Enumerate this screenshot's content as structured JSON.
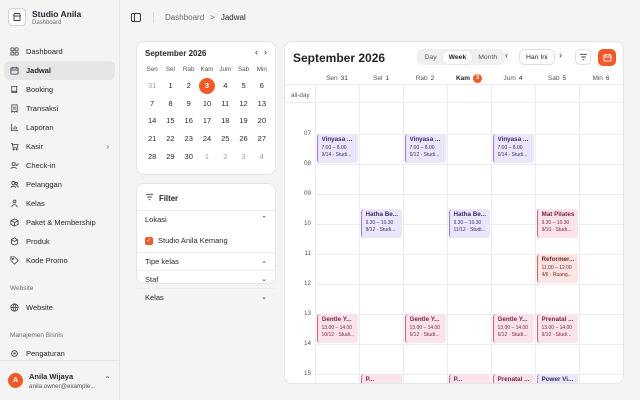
{
  "brand": {
    "title": "Studio Anila",
    "subtitle": "Dashboard"
  },
  "nav": [
    {
      "label": "Dashboard",
      "icon": "grid-icon",
      "active": false
    },
    {
      "label": "Jadwal",
      "icon": "calendar-icon",
      "active": true
    },
    {
      "label": "Booking",
      "icon": "book-icon",
      "active": false
    },
    {
      "label": "Transaksi",
      "icon": "receipt-icon",
      "active": false
    },
    {
      "label": "Laporan",
      "icon": "chart-icon",
      "active": false
    },
    {
      "label": "Kasir",
      "icon": "cart-icon",
      "active": false,
      "chevron": true
    },
    {
      "label": "Check-in",
      "icon": "user-check-icon",
      "active": false
    },
    {
      "label": "Pelanggan",
      "icon": "users-icon",
      "active": false
    },
    {
      "label": "Kelas",
      "icon": "class-icon",
      "active": false
    },
    {
      "label": "Paket & Membership",
      "icon": "package-icon",
      "active": false
    },
    {
      "label": "Produk",
      "icon": "box-icon",
      "active": false
    },
    {
      "label": "Kode Promo",
      "icon": "tag-icon",
      "active": false
    }
  ],
  "sections": {
    "website_label": "Website",
    "website_item": "Website",
    "business_label": "Manajemen Bisnis",
    "business_item": "Pengaturan"
  },
  "user": {
    "initial": "A",
    "name": "Anila Wijaya",
    "email": "anila.owner@example..."
  },
  "breadcrumb": {
    "root": "Dashboard",
    "sep": ">",
    "current": "Jadwal"
  },
  "mini_calendar": {
    "month": "September 2026",
    "prev": "‹",
    "next": "›",
    "dow": [
      "Sen",
      "Sel",
      "Rab",
      "Kam",
      "Jum",
      "Sab",
      "Min"
    ],
    "days": [
      {
        "d": "31",
        "m": true
      },
      {
        "d": "1"
      },
      {
        "d": "2"
      },
      {
        "d": "3",
        "t": true
      },
      {
        "d": "4"
      },
      {
        "d": "5"
      },
      {
        "d": "6"
      },
      {
        "d": "7"
      },
      {
        "d": "8"
      },
      {
        "d": "9"
      },
      {
        "d": "10"
      },
      {
        "d": "11"
      },
      {
        "d": "12"
      },
      {
        "d": "13"
      },
      {
        "d": "14"
      },
      {
        "d": "15"
      },
      {
        "d": "16"
      },
      {
        "d": "17"
      },
      {
        "d": "18"
      },
      {
        "d": "19"
      },
      {
        "d": "20"
      },
      {
        "d": "21"
      },
      {
        "d": "22"
      },
      {
        "d": "23"
      },
      {
        "d": "24"
      },
      {
        "d": "25"
      },
      {
        "d": "26"
      },
      {
        "d": "27"
      },
      {
        "d": "28"
      },
      {
        "d": "29"
      },
      {
        "d": "30"
      },
      {
        "d": "1",
        "m": true
      },
      {
        "d": "2",
        "m": true
      },
      {
        "d": "3",
        "m": true
      },
      {
        "d": "4",
        "m": true
      }
    ]
  },
  "filter": {
    "title": "Filter",
    "lokasi": "Lokasi",
    "option": "Studio Anila Kemang",
    "tipe": "Tipe kelas",
    "staf": "Staf",
    "kelas": "Kelas"
  },
  "week": {
    "title": "September 2026",
    "views": [
      "Day",
      "Week",
      "Month"
    ],
    "active_view": "Week",
    "today_label": "Hari Ini",
    "allday_label": "all-day",
    "days": [
      {
        "name": "Sen",
        "num": "31"
      },
      {
        "name": "Sel",
        "num": "1"
      },
      {
        "name": "Rab",
        "num": "2"
      },
      {
        "name": "Kam",
        "num": "3",
        "today": true
      },
      {
        "name": "Jum",
        "num": "4"
      },
      {
        "name": "Sab",
        "num": "5"
      },
      {
        "name": "Min",
        "num": "6"
      }
    ],
    "hours": [
      "07",
      "08",
      "09",
      "10",
      "11",
      "12",
      "13",
      "14",
      "15"
    ]
  },
  "colors": {
    "accent": "#f05a28",
    "purple_bg": "#ece6fb",
    "purple_border": "#9b7be8",
    "pink_bg": "#fbe3ea",
    "pink_border": "#e0577f",
    "red_bg": "#fde5e4",
    "red_border": "#e65a4e"
  },
  "events": [
    {
      "day": 0,
      "start": 7.0,
      "end": 8.0,
      "color": "purple",
      "title": "Vinyasa ...",
      "time": "7.00 – 8.00",
      "info": "9/14 · Studi..."
    },
    {
      "day": 2,
      "start": 7.0,
      "end": 8.0,
      "color": "purple",
      "title": "Vinyasa ...",
      "time": "7.00 – 8.00",
      "info": "6/12 · Studi..."
    },
    {
      "day": 4,
      "start": 7.0,
      "end": 8.0,
      "color": "purple",
      "title": "Vinyasa ...",
      "time": "7.00 – 8.00",
      "info": "6/14 · Studi..."
    },
    {
      "day": 1,
      "start": 9.5,
      "end": 10.5,
      "color": "purple",
      "title": "Hatha Be...",
      "time": "9.30 – 10.30",
      "info": "8/12 · Studi..."
    },
    {
      "day": 3,
      "start": 9.5,
      "end": 10.5,
      "color": "purple",
      "title": "Hatha Be...",
      "time": "9.30 – 10.30",
      "info": "11/12 · Studi..."
    },
    {
      "day": 5,
      "start": 9.5,
      "end": 10.5,
      "color": "pink",
      "title": "Mat Pilates",
      "time": "9.30 – 10.30",
      "info": "9/10 · Studi..."
    },
    {
      "day": 5,
      "start": 11.0,
      "end": 12.0,
      "color": "red",
      "title": "Reformer...",
      "time": "11.00 – 12.00",
      "info": "4/6 · Ruang..."
    },
    {
      "day": 0,
      "start": 13.0,
      "end": 14.0,
      "color": "pink",
      "title": "Gentle Y...",
      "time": "13.00 – 14.00",
      "info": "10/12 · Studi..."
    },
    {
      "day": 2,
      "start": 13.0,
      "end": 14.0,
      "color": "pink",
      "title": "Gentle Y...",
      "time": "13.00 – 14.00",
      "info": "6/12 · Studi..."
    },
    {
      "day": 4,
      "start": 13.0,
      "end": 14.0,
      "color": "pink",
      "title": "Gentle Y...",
      "time": "13.00 – 14.00",
      "info": "6/12 · Studi..."
    },
    {
      "day": 5,
      "start": 13.0,
      "end": 14.0,
      "color": "pink",
      "title": "Prenatal ...",
      "time": "13.00 – 14.00",
      "info": "9/10 · Studi..."
    },
    {
      "day": 1,
      "start": 15.0,
      "end": 16.0,
      "color": "pink",
      "title": "P...",
      "time": "",
      "info": ""
    },
    {
      "day": 3,
      "start": 15.0,
      "end": 16.0,
      "color": "pink",
      "title": "P...",
      "time": "",
      "info": ""
    },
    {
      "day": 4,
      "start": 15.0,
      "end": 16.0,
      "color": "pink",
      "title": "Prenatal ...",
      "time": "",
      "info": ""
    },
    {
      "day": 5,
      "start": 15.0,
      "end": 16.0,
      "color": "purple",
      "title": "Power Vi...",
      "time": "",
      "info": ""
    }
  ]
}
